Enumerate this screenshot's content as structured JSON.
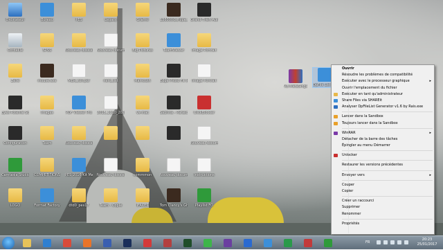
{
  "desktop": {
    "icons": [
      {
        "label": "Ordinateur",
        "type": "computer"
      },
      {
        "label": "Bureau",
        "type": "blue"
      },
      {
        "label": "PES",
        "type": "folder"
      },
      {
        "label": "Legacy",
        "type": "folder"
      },
      {
        "label": "Graffiti",
        "type": "folder"
      },
      {
        "label": "1360000_Hope_Sign...",
        "type": "game"
      },
      {
        "label": "Grand Theft Auto IV",
        "type": "dark"
      },
      {
        "label": "Corbeille",
        "type": "bin"
      },
      {
        "label": "SPSS",
        "type": "folder"
      },
      {
        "label": "Nouveau dossier (4)",
        "type": "folder"
      },
      {
        "label": "Nouveau document texte",
        "type": "file"
      },
      {
        "label": "Big Pictures",
        "type": "folder"
      },
      {
        "label": "TeamViewer",
        "type": "blue"
      },
      {
        "label": "Image Portrait",
        "type": "folder"
      },
      {
        "label": "Zelie",
        "type": "folder"
      },
      {
        "label": "mouse.exe",
        "type": "game"
      },
      {
        "label": "MBR_full.pdf",
        "type": "file"
      },
      {
        "label": "nerd_list",
        "type": "file"
      },
      {
        "label": "Mamouth",
        "type": "folder"
      },
      {
        "label": "Edge Photo Fit (64-bit)",
        "type": "dark"
      },
      {
        "label": "Image Portrait",
        "type": "file"
      },
      {
        "label": "Eyes Potente Screen 2016",
        "type": "dark"
      },
      {
        "label": "Images",
        "type": "folder"
      },
      {
        "label": "PDF Viewer Pro",
        "type": "blue"
      },
      {
        "label": "2015_1110_2025",
        "type": "file"
      },
      {
        "label": "vs-mac",
        "type": "folder"
      },
      {
        "label": "Sabrina - Parasoleil",
        "type": "dark"
      },
      {
        "label": "ClickBlocker",
        "type": "red"
      },
      {
        "label": "Configuration",
        "type": "dark"
      },
      {
        "label": "Team",
        "type": "folder"
      },
      {
        "label": "Nouveau dossier (2)",
        "type": "folder"
      },
      {
        "label": "",
        "type": "folder"
      },
      {
        "label": "",
        "type": "folder"
      },
      {
        "label": "",
        "type": "dark"
      },
      {
        "label": "Nouveau document texte",
        "type": "file"
      },
      {
        "label": "Camtasia Studio 9",
        "type": "green"
      },
      {
        "label": "COMPETITIONS",
        "type": "folder"
      },
      {
        "label": "PES 2016 Kit Manager",
        "type": "blue"
      },
      {
        "label": "Nouveau dossier (2).zip",
        "type": "file"
      },
      {
        "label": "commmon",
        "type": "folder"
      },
      {
        "label": "Nouveau document texte",
        "type": "file"
      },
      {
        "label": "Instructions",
        "type": "file"
      },
      {
        "label": "LOGO",
        "type": "folder"
      },
      {
        "label": "Format Factory",
        "type": "blue"
      },
      {
        "label": "dtd0_pes17",
        "type": "folder"
      },
      {
        "label": "Team - Cople",
        "type": "folder"
      },
      {
        "label": "IFACES",
        "type": "folder"
      },
      {
        "label": "Tom Clancy's Ghost Recon",
        "type": "game"
      },
      {
        "label": "Playlist FO",
        "type": "green"
      }
    ],
    "extra_icons": [
      {
        "label": "VE-MetaSingle IDP List - Sunrise...",
        "type": "winrar"
      },
      {
        "label": "DpFile List Generator Rais...",
        "type": "blue"
      }
    ]
  },
  "context_menu": {
    "items": [
      {
        "label": "Ouvrir",
        "bold": true,
        "arrow": false,
        "icon": ""
      },
      {
        "label": "Résoudre les problèmes de compatibilité",
        "arrow": false,
        "icon": ""
      },
      {
        "label": "Exécuter avec le processeur graphique",
        "arrow": true,
        "icon": ""
      },
      {
        "label": "Ouvrir l'emplacement du fichier",
        "arrow": false,
        "icon": ""
      },
      {
        "label": "Exécuter en tant qu'administrateur",
        "arrow": false,
        "icon": "#e8b84a"
      },
      {
        "label": "Share Files via SHAREit",
        "arrow": false,
        "icon": "#3c8fd9"
      },
      {
        "label": "Analyser DpFileList Generator v1.6 by Rais.exe",
        "arrow": false,
        "icon": "#2e6fbf"
      },
      {
        "sep": true
      },
      {
        "label": "Lancer dans la Sandbox",
        "arrow": false,
        "icon": "#e8a02a"
      },
      {
        "label": "Toujours lancer dans la Sandbox",
        "arrow": false,
        "icon": "#e8a02a"
      },
      {
        "sep": true
      },
      {
        "label": "WinRAR",
        "arrow": true,
        "icon": "#7b3aa8"
      },
      {
        "label": "Détacher de la barre des tâches",
        "arrow": false,
        "icon": ""
      },
      {
        "label": "Épingler au menu Démarrer",
        "arrow": false,
        "icon": ""
      },
      {
        "sep": true
      },
      {
        "label": "Unlocker",
        "arrow": false,
        "icon": "#c93030"
      },
      {
        "sep": true
      },
      {
        "label": "Restaurer les versions précédentes",
        "arrow": false,
        "icon": ""
      },
      {
        "sep": true
      },
      {
        "label": "Envoyer vers",
        "arrow": true,
        "icon": ""
      },
      {
        "sep": true
      },
      {
        "label": "Couper",
        "arrow": false,
        "icon": ""
      },
      {
        "label": "Copier",
        "arrow": false,
        "icon": ""
      },
      {
        "sep": true
      },
      {
        "label": "Créer un raccourci",
        "arrow": false,
        "icon": ""
      },
      {
        "label": "Supprimer",
        "arrow": false,
        "icon": ""
      },
      {
        "label": "Renommer",
        "arrow": false,
        "icon": ""
      },
      {
        "sep": true
      },
      {
        "label": "Propriétés",
        "arrow": false,
        "icon": ""
      }
    ]
  },
  "taskbar": {
    "apps": [
      {
        "name": "explorer-icon",
        "color": "#e6c25a"
      },
      {
        "name": "media-player-icon",
        "color": "#2f7fd0"
      },
      {
        "name": "chrome-icon",
        "color": "#d84b3a"
      },
      {
        "name": "firefox-icon",
        "color": "#e8742a"
      },
      {
        "name": "media-icon",
        "color": "#3a5fb0"
      },
      {
        "name": "photoshop-icon",
        "color": "#1a2f5a"
      },
      {
        "name": "media-tool-icon",
        "color": "#d33a3a"
      },
      {
        "name": "player-icon",
        "color": "#b34040"
      },
      {
        "name": "terminal-icon",
        "color": "#1f4d2a"
      },
      {
        "name": "chat-icon",
        "color": "#3db54a"
      },
      {
        "name": "video-editor-icon",
        "color": "#6a3fa0"
      },
      {
        "name": "pes-icon",
        "color": "#2a6ad0"
      },
      {
        "name": "tool-icon",
        "color": "#3c8fd9"
      },
      {
        "name": "app-icon",
        "color": "#2a9a4a"
      },
      {
        "name": "app2-icon",
        "color": "#c23a3a"
      },
      {
        "name": "camtasia-icon",
        "color": "#2f9a3a"
      }
    ],
    "language": "FR",
    "time": "20:23",
    "date": "25/01/2017"
  }
}
